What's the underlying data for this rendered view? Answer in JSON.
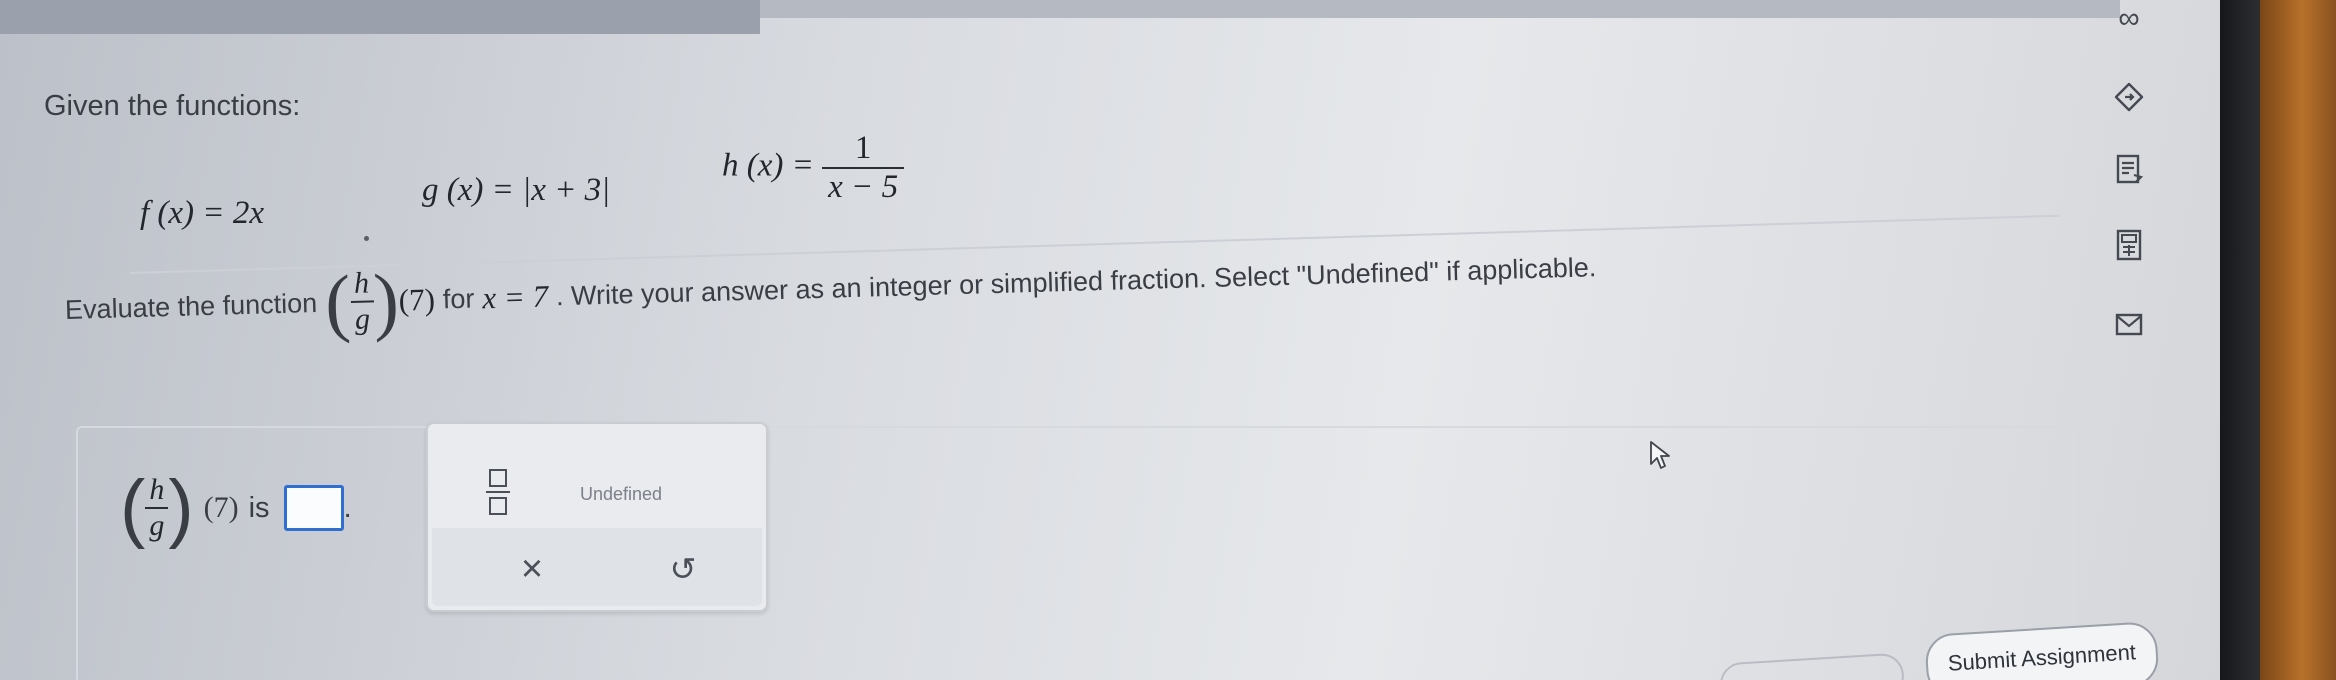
{
  "question": {
    "heading": "Given the functions:",
    "f": {
      "lhs": "f (x) =",
      "rhs": "2x"
    },
    "g": {
      "lhs": "g (x) =",
      "rhs": "|x + 3|"
    },
    "h": {
      "lhs": "h (x) =",
      "numerator": "1",
      "denominator": "x − 5"
    },
    "prompt_before": "Evaluate the function",
    "prompt_frac_num": "h",
    "prompt_frac_den": "g",
    "prompt_arg": "(7)",
    "prompt_for": "for",
    "prompt_condition": "x = 7",
    "prompt_after": ". Write your answer as an integer or simplified fraction. Select \"Undefined\" if applicable."
  },
  "answer": {
    "frac_num": "h",
    "frac_den": "g",
    "arg": "(7)",
    "is_label": "is",
    "end_period": ".",
    "input_value": ""
  },
  "palette": {
    "undefined_label": "Undefined",
    "clear_symbol": "×",
    "undo_symbol": "↺"
  },
  "sidebar": {
    "infinity_symbol": "∞"
  },
  "footer": {
    "submit_label": "Submit Assignment"
  }
}
